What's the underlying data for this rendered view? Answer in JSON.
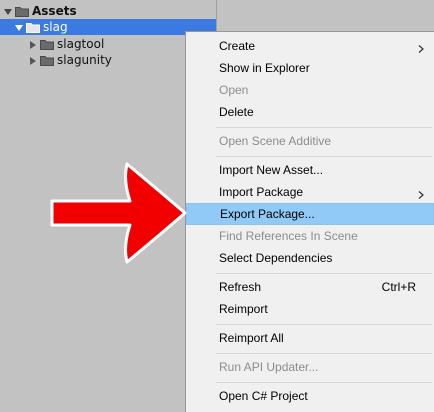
{
  "tree": {
    "root": {
      "label": "Assets",
      "expanded": true
    },
    "items": [
      {
        "label": "slag",
        "selected": true,
        "expanded": true
      },
      {
        "label": "slagtool",
        "selected": false,
        "expanded": false
      },
      {
        "label": "slagunity",
        "selected": false,
        "expanded": false
      }
    ]
  },
  "menu": {
    "items": [
      {
        "label": "Create",
        "submenu": true,
        "enabled": true
      },
      {
        "label": "Show in Explorer",
        "enabled": true
      },
      {
        "label": "Open",
        "enabled": false
      },
      {
        "label": "Delete",
        "enabled": true
      },
      {
        "label": "Open Scene Additive",
        "enabled": false
      },
      {
        "label": "Import New Asset...",
        "enabled": true
      },
      {
        "label": "Import Package",
        "submenu": true,
        "enabled": true
      },
      {
        "label": "Export Package...",
        "enabled": true,
        "highlighted": true
      },
      {
        "label": "Find References In Scene",
        "enabled": false
      },
      {
        "label": "Select Dependencies",
        "enabled": true
      },
      {
        "label": "Refresh",
        "shortcut": "Ctrl+R",
        "enabled": true
      },
      {
        "label": "Reimport",
        "enabled": true
      },
      {
        "label": "Reimport All",
        "enabled": true
      },
      {
        "label": "Run API Updater...",
        "enabled": false
      },
      {
        "label": "Open C# Project",
        "enabled": true
      }
    ]
  },
  "colors": {
    "selection": "#3b7ae0",
    "menu_highlight": "#91c9f7",
    "arrow": "#ff0000"
  },
  "icons": {
    "foldout_expanded": "triangle-down-icon",
    "foldout_collapsed": "triangle-right-icon",
    "folder": "folder-icon",
    "submenu": "chevron-right-icon"
  }
}
